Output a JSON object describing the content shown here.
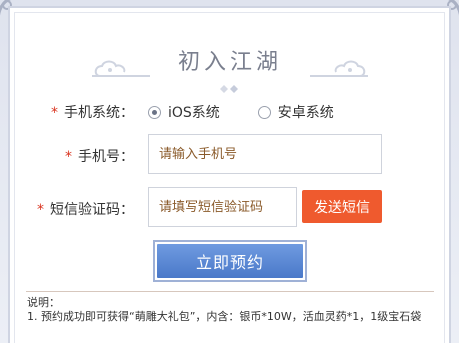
{
  "title": "初入江湖",
  "form": {
    "os": {
      "label": "手机系统：",
      "required_mark": "*",
      "options": [
        {
          "label": "iOS系统",
          "checked": true
        },
        {
          "label": "安卓系统",
          "checked": false
        }
      ]
    },
    "phone": {
      "label": "手机号：",
      "required_mark": "*",
      "placeholder": "请输入手机号",
      "value": ""
    },
    "sms_code": {
      "label": "短信验证码：",
      "required_mark": "*",
      "placeholder": "请填写短信验证码",
      "value": "",
      "send_button_label": "发送短信"
    },
    "submit_label": "立即预约"
  },
  "notes": {
    "heading": "说明：",
    "lines": [
      "1. 预约成功即可获得“萌雕大礼包”，内含：银币*10W，活血灵药*1，1级宝石袋"
    ]
  },
  "colors": {
    "accent_orange": "#ef5a2e",
    "submit_blue": "#4a79c9",
    "required_red": "#d9331f",
    "placeholder_brown": "#8a5a2a"
  }
}
